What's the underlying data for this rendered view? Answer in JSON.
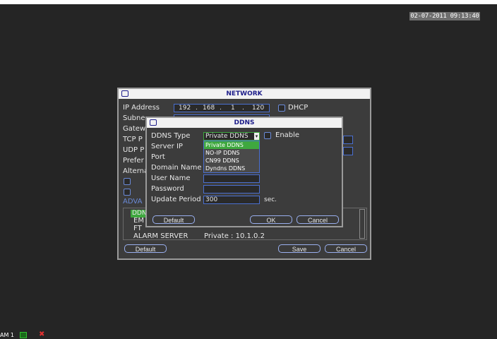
{
  "clock": "02-07-2011 09:13:40",
  "network": {
    "title": "NETWORK",
    "ip_label": "IP Address",
    "ip_octets": [
      "192",
      "168",
      "1",
      "120"
    ],
    "dhcp_label": "DHCP",
    "subnet_label": "Subne",
    "gateway_label": "Gatew",
    "tcp_label": "TCP P",
    "udp_label": "UDP P",
    "preferred_label": "Prefer",
    "alternate_label": "Alterna",
    "advanced_label": "ADVA",
    "list_items": [
      "DDN",
      "EM",
      "FT"
    ],
    "alarm_server_label": "ALARM SERVER",
    "alarm_server_value": "Private : 10.1.0.2",
    "default_button": "Default",
    "save_button": "Save",
    "cancel_button": "Cancel"
  },
  "ddns": {
    "title": "DDNS",
    "type_label": "DDNS Type",
    "type_value": "Private DDNS",
    "enable_label": "Enable",
    "server_ip_label": "Server IP",
    "port_label": "Port",
    "domain_name_label": "Domain Name",
    "user_name_label": "User Name",
    "password_label": "Password",
    "update_period_label": "Update Period",
    "update_period_value": "300",
    "update_period_unit": "sec.",
    "options": [
      "Private DDNS",
      "NO-IP DDNS",
      "CN99 DDNS",
      "Dyndns DDNS"
    ],
    "default_button": "Default",
    "ok_button": "OK",
    "cancel_button": "Cancel"
  },
  "status": {
    "channel_label": "AM 1"
  },
  "colors": {
    "background": "#252525",
    "dialog_bg": "#3c3c3c",
    "title_text": "#1d1d8a",
    "highlight": "#3fa83f",
    "field_border": "#4a6fd0"
  }
}
